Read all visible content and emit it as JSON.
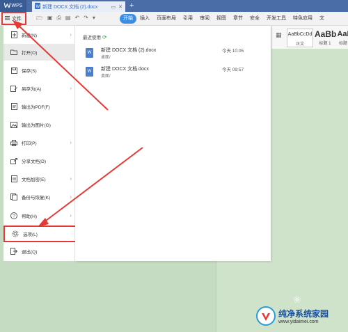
{
  "titlebar": {
    "app_label": "WPS",
    "doc_tab": "新建 DOCX 文档 (2).docx",
    "new_tab": "+"
  },
  "toolbar": {
    "file_label": "文件",
    "ribbon_tabs": [
      "开始",
      "插入",
      "页面布局",
      "引用",
      "审阅",
      "视图",
      "章节",
      "安全",
      "开发工具",
      "特色应用",
      "文"
    ]
  },
  "styles": [
    {
      "sample": "AaBbCcDd",
      "label": "正文"
    },
    {
      "sample": "AaBb",
      "label": "标题 1"
    },
    {
      "sample": "AaI",
      "label": "标题"
    }
  ],
  "menu": {
    "items": [
      {
        "label": "新建(N)",
        "icon": "new-doc-icon",
        "arrow": true
      },
      {
        "label": "打开(O)",
        "icon": "folder-icon",
        "arrow": false
      },
      {
        "label": "保存(S)",
        "icon": "save-icon",
        "arrow": false
      },
      {
        "label": "另存为(A)",
        "icon": "save-as-icon",
        "arrow": true
      },
      {
        "label": "输出为PDF(F)",
        "icon": "pdf-icon",
        "arrow": false
      },
      {
        "label": "输出为图片(G)",
        "icon": "image-icon",
        "arrow": false
      },
      {
        "label": "打印(P)",
        "icon": "printer-icon",
        "arrow": true
      },
      {
        "label": "分享文档(D)",
        "icon": "share-icon",
        "arrow": false
      },
      {
        "label": "文档加密(E)",
        "icon": "encrypt-icon",
        "arrow": true
      },
      {
        "label": "备份与恢复(K)",
        "icon": "backup-icon",
        "arrow": true
      },
      {
        "label": "帮助(H)",
        "icon": "help-icon",
        "arrow": true
      },
      {
        "label": "选项(L)",
        "icon": "gear-icon",
        "arrow": false
      },
      {
        "label": "退出(Q)",
        "icon": "exit-icon",
        "arrow": false
      }
    ]
  },
  "recent": {
    "title": "最近使用",
    "files": [
      {
        "name": "新建 DOCX 文档 (2).docx",
        "path": "桌面/",
        "time": "今天 10:05"
      },
      {
        "name": "新建 DOCX 文档.docx",
        "path": "桌面/",
        "time": "今天 09:57"
      }
    ]
  },
  "watermark": {
    "title": "纯净系统家园",
    "url": "www.yidaimei.com"
  },
  "colors": {
    "titlebar": "#4a6da7",
    "accent": "#3a8ee6",
    "annotation_red": "#e53935",
    "background": "#c6dcc2"
  }
}
